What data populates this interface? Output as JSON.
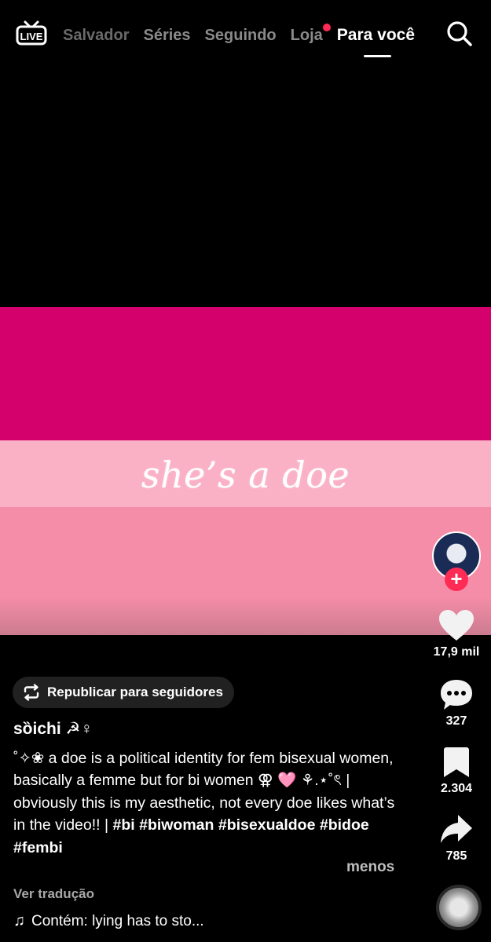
{
  "nav": {
    "tabs": [
      {
        "label": "Salvador"
      },
      {
        "label": "Séries"
      },
      {
        "label": "Seguindo"
      },
      {
        "label": "Loja"
      },
      {
        "label": "Para você"
      }
    ],
    "active_tab": "Para você",
    "notification_color": "#fe2c55",
    "live_icon": "live-tv-icon",
    "search_icon": "search-icon"
  },
  "video": {
    "overlay_text": "she’s a doe",
    "stripe_colors": [
      "#d4006b",
      "#fab1c6",
      "#f58da8"
    ]
  },
  "rail": {
    "follow_symbol": "+",
    "likes": "17,9 mil",
    "comments": "327",
    "saves": "2.304",
    "shares": "785"
  },
  "info": {
    "repost_label": "Republicar para seguidores",
    "username": "sȍichi ☭♀",
    "description_text": "˚✧❀ a doe is a political identity for fem bisexual women, basically a femme but for bi women ⚢ 🩷 ⚘.⋆˚ৎ | obviously this is my aesthetic, not every doe likes what’s in the video!! |",
    "hashtags": [
      "#bi",
      "#biwoman",
      "#bisexualdoe",
      "#bidoe",
      "#fembi"
    ],
    "less_label": "menos",
    "translate_label": "Ver tradução",
    "music_label": "Contém: lying has to sto..."
  }
}
